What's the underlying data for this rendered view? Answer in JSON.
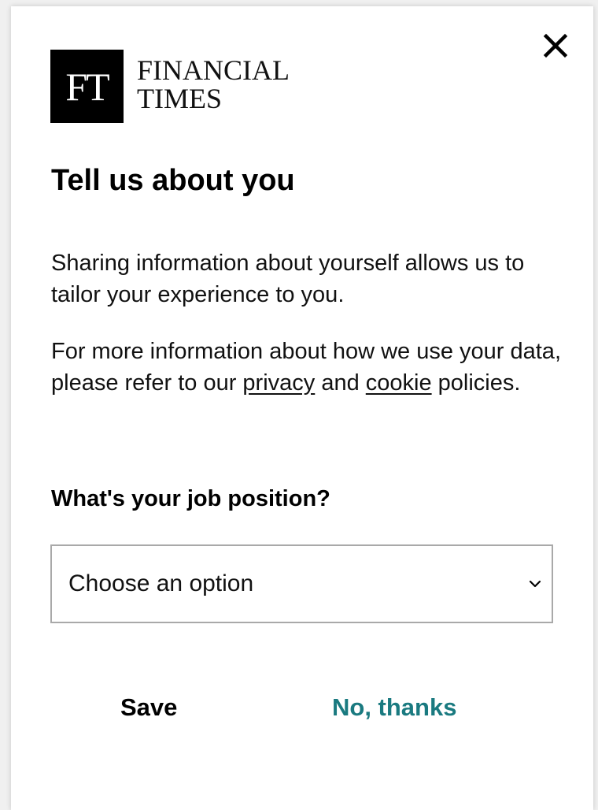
{
  "logo": {
    "mark": "FT",
    "line1": "FINANCIAL",
    "line2": "TIMES"
  },
  "modal": {
    "title": "Tell us about you",
    "intro": "Sharing information about yourself allows us to tailor your experience to you.",
    "info_before": "For more information about how we use your data, please refer to our ",
    "privacy_link": "privacy",
    "info_and": " and ",
    "cookie_link": "cookie",
    "info_after": " policies."
  },
  "job_question": {
    "label": "What's your job position?",
    "selected_value": "Choose an option"
  },
  "actions": {
    "save_label": "Save",
    "decline_label": "No, thanks"
  },
  "colors": {
    "accent": "#1a7a80",
    "logo_bg": "#000000"
  },
  "icons": {
    "close": "close-icon",
    "dropdown": "chevron-down-icon"
  }
}
